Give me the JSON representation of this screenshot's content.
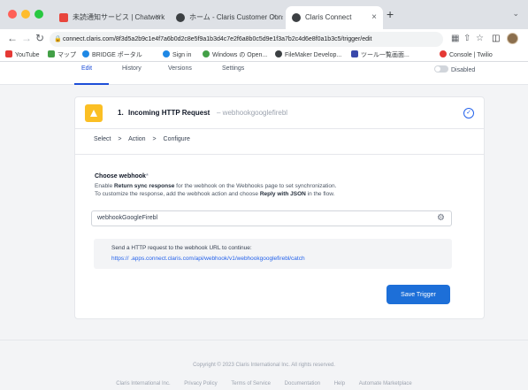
{
  "browser": {
    "tabs": [
      {
        "label": "未読通知サービス | Chatwork",
        "active": false,
        "favicon_color": "#e8453c"
      },
      {
        "label": "ホーム - Claris Customer Consol",
        "active": false,
        "favicon_color": "#3c4043"
      },
      {
        "label": "Claris Connect",
        "active": true,
        "favicon_color": "#3c4043"
      }
    ],
    "url": "connect.claris.com/8f3d5a2b9c1e4f7a6b0d2c8e5f9a1b3d4c7e2f6a8b0c5d9e1f3a7b2c4d6e8f0a1b3c5/trigger/edit",
    "bookmarks": [
      {
        "label": "YouTube",
        "color": "#e53935"
      },
      {
        "label": "マップ",
        "color": "#43a047"
      },
      {
        "label": "BRIDGE ポータル",
        "color": "#1e88e5"
      },
      {
        "label": "Sign in",
        "color": "#1e88e5"
      },
      {
        "label": "Windows の Open...",
        "color": "#43a047"
      },
      {
        "label": "FileMaker Develop...",
        "color": "#3c4043"
      },
      {
        "label": "ツール一覧画面...",
        "color": "#3949ab"
      },
      {
        "label": "Console | Twilio",
        "color": "#e53935"
      }
    ]
  },
  "app": {
    "tabs": [
      {
        "label": "Edit",
        "active": true
      },
      {
        "label": "History",
        "active": false
      },
      {
        "label": "Versions",
        "active": false
      },
      {
        "label": "Settings",
        "active": false
      }
    ],
    "disabled_label": "Disabled",
    "step": {
      "number": "1.",
      "title": "Incoming HTTP Request",
      "subtitle": "– webhookgooglefirebl"
    },
    "breadcrumb": [
      "Select",
      "Action",
      "Configure"
    ],
    "breadcrumb_separator": ">",
    "section_title": "Choose webhook",
    "section_required": "*",
    "description": {
      "line1_pre": "Enable ",
      "line1_bold": "Return sync response",
      "line1_post": " for the webhook on the Webhooks page to set synchronization.",
      "line2_pre": "To customize the response, add the webhook action and choose ",
      "line2_bold": "Reply with JSON",
      "line2_post": " in the flow."
    },
    "webhook_value": "webhookGoogleFirebl",
    "info_text": "Send a HTTP request to the webhook URL to continue:",
    "info_url": "https://        .apps.connect.claris.com/api/webhook/v1/webhookgooglefirebl/catch",
    "save_button": "Save Trigger"
  },
  "footer": {
    "copyright": "Copyright © 2023 Claris International Inc. All rights reserved.",
    "links": [
      "Claris International Inc.",
      "Privacy Policy",
      "Terms of Service",
      "Documentation",
      "Help",
      "Automate Marketplace"
    ]
  }
}
